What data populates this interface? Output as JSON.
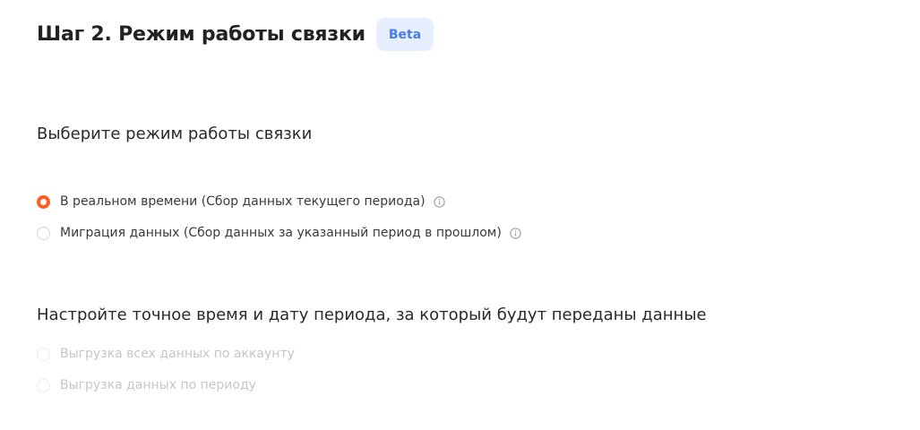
{
  "header": {
    "title": "Шаг 2. Режим работы связки",
    "badge": "Beta"
  },
  "mode_section": {
    "title": "Выберите режим работы связки",
    "options": [
      {
        "label": "В реальном времени (Сбор данных текущего периода)",
        "selected": true,
        "has_info": true
      },
      {
        "label": "Миграция данных (Сбор данных за указанный период в прошлом)",
        "selected": false,
        "has_info": true
      }
    ]
  },
  "period_section": {
    "title": "Настройте точное время и дату периода, за который будут переданы данные",
    "options": [
      {
        "label": "Выгрузка всех данных по аккаунту",
        "selected": false,
        "disabled": true
      },
      {
        "label": "Выгрузка данных по периоду",
        "selected": false,
        "disabled": true
      }
    ]
  },
  "colors": {
    "accent": "#ff5b22",
    "badge_bg": "#e7efff",
    "badge_text": "#4a7cf0",
    "disabled_text": "#c6c6c6",
    "info_icon": "#a8a8a8"
  },
  "icons": {
    "info": "info-circle-icon"
  }
}
